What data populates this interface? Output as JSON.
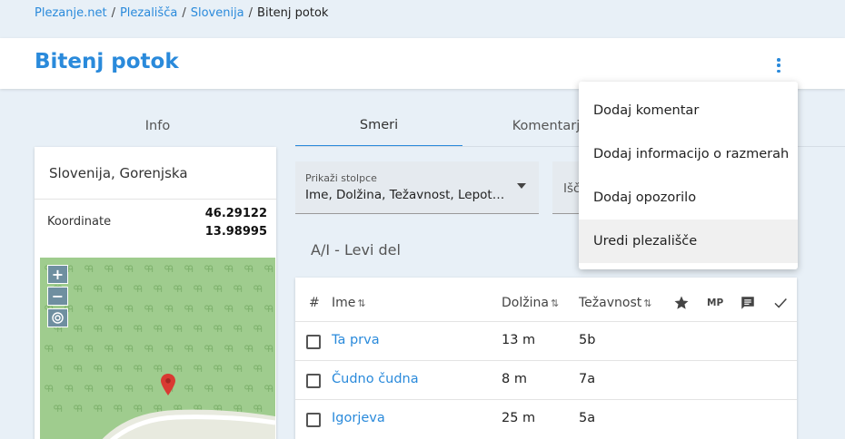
{
  "breadcrumb": {
    "items": [
      "Plezanje.net",
      "Plezališča",
      "Slovenija"
    ],
    "separator": "/",
    "current": "Bitenj potok"
  },
  "page": {
    "title": "Bitenj potok"
  },
  "tabs": [
    "Info",
    "Smeri",
    "Komentarj"
  ],
  "info": {
    "region": "Slovenija, Gorenjska",
    "coord_label": "Koordinate",
    "lat": "46.29122",
    "lon": "13.98995"
  },
  "map": {
    "zoom_in": "+",
    "zoom_out": "−"
  },
  "filters": {
    "columns_label": "Prikaži stolpce",
    "columns_value": "Ime, Dolžina, Težavnost, Lepota …",
    "search_placeholder": "Išč"
  },
  "sector": {
    "title": "A/I - Levi del"
  },
  "table": {
    "headers": {
      "num": "#",
      "name": "Ime",
      "length": "Dolžina",
      "grade": "Težavnost",
      "mp": "MP",
      "sort": "⇅"
    },
    "rows": [
      {
        "name": "Ta prva",
        "length": "13 m",
        "grade": "5b"
      },
      {
        "name": "Čudno čudna",
        "length": "8 m",
        "grade": "7a"
      },
      {
        "name": "Igorjeva",
        "length": "25 m",
        "grade": "5a"
      }
    ]
  },
  "menu": {
    "items": [
      "Dodaj komentar",
      "Dodaj informacijo o razmerah",
      "Dodaj opozorilo",
      "Uredi plezališče"
    ]
  },
  "colors": {
    "accent": "#2a8adb",
    "map_green": "#9fcc8e",
    "marker": "#d93a32"
  }
}
